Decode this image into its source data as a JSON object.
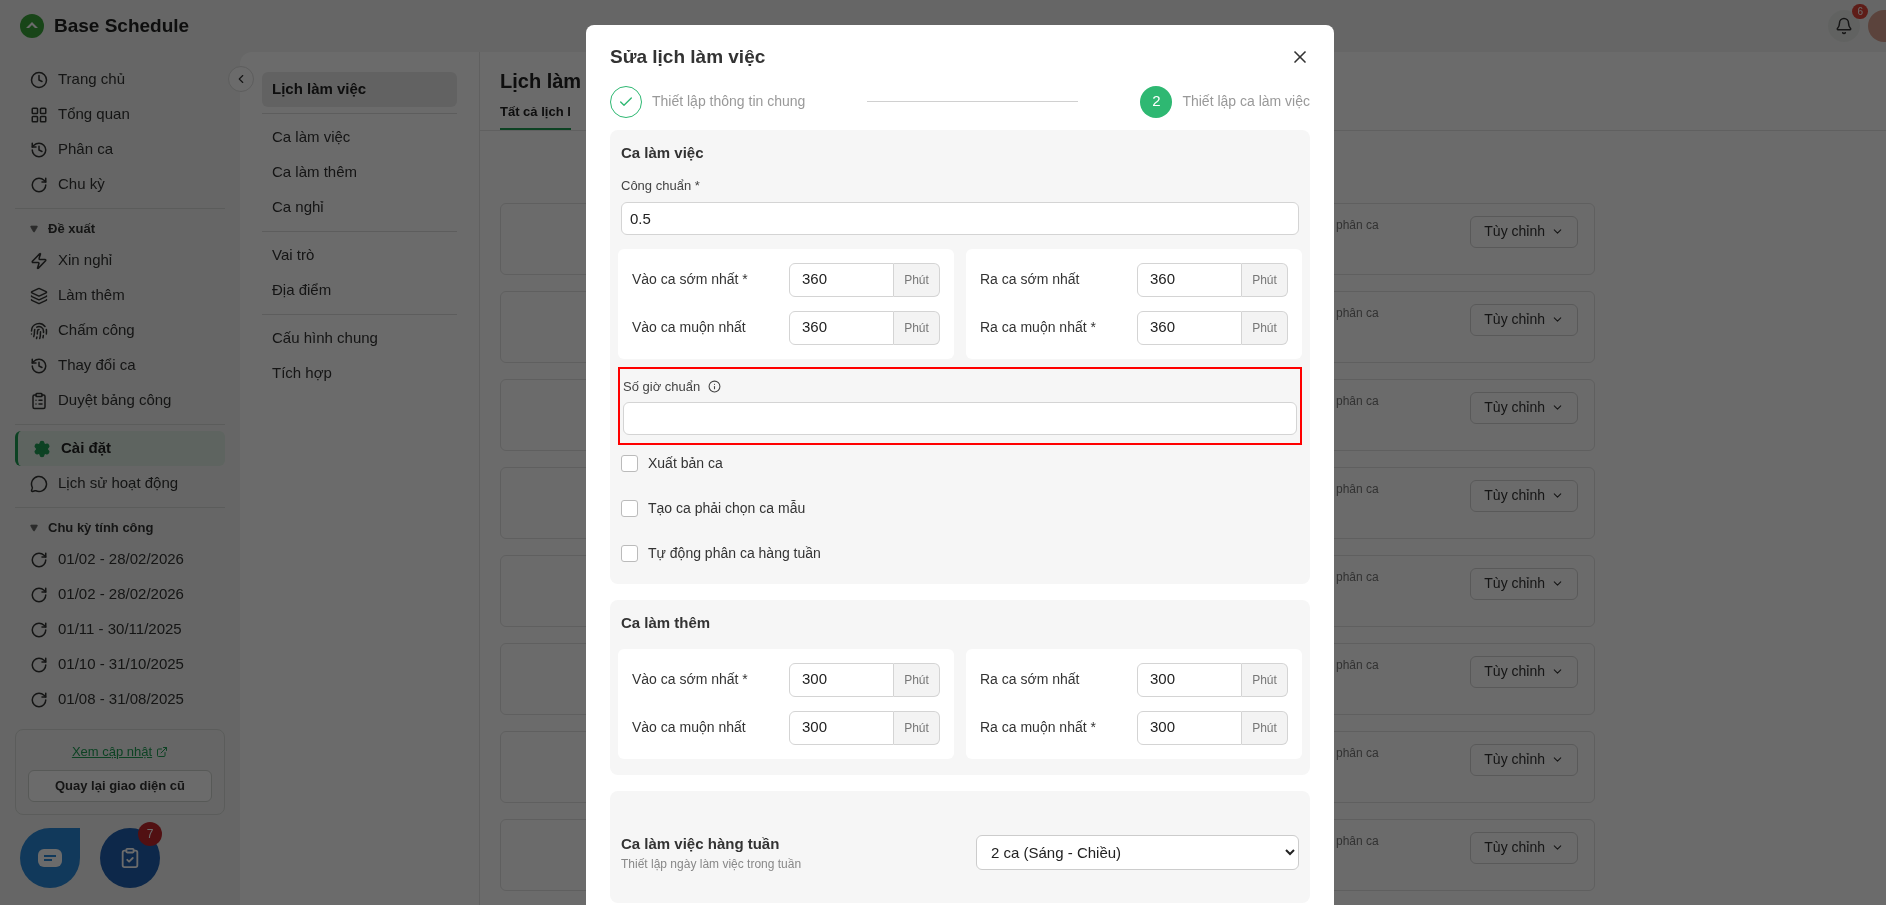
{
  "app": {
    "title": "Base Schedule"
  },
  "header": {
    "notification_count": "6"
  },
  "sidebar": {
    "groups": [
      {
        "items": [
          {
            "label": "Trang chủ",
            "selected": false
          },
          {
            "label": "Tổng quan",
            "selected": false
          },
          {
            "label": "Phân ca",
            "selected": false
          },
          {
            "label": "Chu kỳ",
            "selected": false
          }
        ]
      },
      {
        "heading": "Đề xuất",
        "expanded": true,
        "items": [
          {
            "label": "Xin nghỉ",
            "selected": false
          },
          {
            "label": "Làm thêm",
            "selected": false
          },
          {
            "label": "Chấm công",
            "selected": false
          },
          {
            "label": "Thay đổi ca",
            "selected": false
          },
          {
            "label": "Duyệt bảng công",
            "selected": false
          }
        ]
      },
      {
        "items": [
          {
            "label": "Cài đặt",
            "selected": true
          },
          {
            "label": "Lịch sử hoạt động",
            "selected": false
          }
        ]
      },
      {
        "heading": "Chu kỳ tính công",
        "expanded": true,
        "items": [
          {
            "label": "01/02 - 28/02/2026",
            "selected": false
          },
          {
            "label": "01/02 - 28/02/2026",
            "selected": false
          },
          {
            "label": "01/11 - 30/11/2025",
            "selected": false
          },
          {
            "label": "01/10 - 31/10/2025",
            "selected": false
          },
          {
            "label": "01/08 - 31/08/2025",
            "selected": false
          }
        ]
      }
    ],
    "update_link": "Xem cập nhật",
    "legacy_button": "Quay lại giao diện cũ"
  },
  "settings_nav": {
    "groups": [
      [
        {
          "label": "Lịch làm việc",
          "selected": true
        }
      ],
      [
        {
          "label": "Ca làm việc",
          "selected": false
        },
        {
          "label": "Ca làm thêm",
          "selected": false
        },
        {
          "label": "Ca nghỉ",
          "selected": false
        }
      ],
      [
        {
          "label": "Vai trò",
          "selected": false
        },
        {
          "label": "Địa điểm",
          "selected": false
        }
      ],
      [
        {
          "label": "Cấu hình chung",
          "selected": false
        },
        {
          "label": "Tích hợp",
          "selected": false
        }
      ]
    ]
  },
  "main": {
    "title": "Lịch làm",
    "tabs": [
      {
        "label": "Tất cả lịch l",
        "selected": true
      }
    ],
    "cards": [
      {
        "text": "phân ca",
        "button": "Tùy chỉnh"
      },
      {
        "text": "phân ca",
        "button": "Tùy chỉnh"
      },
      {
        "text": "phân ca",
        "button": "Tùy chỉnh"
      },
      {
        "text": "phân ca",
        "button": "Tùy chỉnh"
      },
      {
        "text": "phân ca",
        "button": "Tùy chỉnh"
      },
      {
        "text": "phân ca",
        "button": "Tùy chỉnh"
      },
      {
        "text": "phân ca",
        "button": "Tùy chỉnh"
      },
      {
        "text": "phân ca",
        "button": "Tùy chỉnh"
      }
    ]
  },
  "floating": {
    "task_badge": "7"
  },
  "modal": {
    "title": "Sửa lịch làm việc",
    "steps": [
      {
        "label": "Thiết lập thông tin chung",
        "completed": true,
        "active": false
      },
      {
        "number": "2",
        "label": "Thiết lập ca làm việc",
        "completed": false,
        "active": true
      }
    ],
    "work_shift": {
      "title": "Ca làm việc",
      "standard_workday": {
        "label": "Công chuẩn *",
        "value": "0.5"
      },
      "panels": [
        [
          {
            "label": "Vào ca sớm nhất *",
            "value": "360",
            "unit": "Phút"
          },
          {
            "label": "Vào ca muộn nhất",
            "value": "360",
            "unit": "Phút"
          }
        ],
        [
          {
            "label": "Ra ca sớm nhất",
            "value": "360",
            "unit": "Phút"
          },
          {
            "label": "Ra ca muộn nhất *",
            "value": "360",
            "unit": "Phút"
          }
        ]
      ],
      "standard_hours": {
        "label": "Số giờ chuẩn",
        "highlighted": true
      },
      "options": [
        {
          "label": "Xuất bản ca",
          "checked": false
        },
        {
          "label": "Tạo ca phải chọn ca mẫu",
          "checked": false
        },
        {
          "label": "Tự động phân ca hàng tuần",
          "checked": false
        }
      ]
    },
    "overtime": {
      "title": "Ca làm thêm",
      "panels": [
        [
          {
            "label": "Vào ca sớm nhất *",
            "value": "300",
            "unit": "Phút"
          },
          {
            "label": "Vào ca muộn nhất",
            "value": "300",
            "unit": "Phút"
          }
        ],
        [
          {
            "label": "Ra ca sớm nhất",
            "value": "300",
            "unit": "Phút"
          },
          {
            "label": "Ra ca muộn nhất *",
            "value": "300",
            "unit": "Phút"
          }
        ]
      ]
    },
    "weekly": {
      "title": "Ca làm việc hàng tuần",
      "subtitle": "Thiết lập ngày làm việc trong tuần",
      "value": "2 ca (Sáng - Chiều)"
    }
  }
}
